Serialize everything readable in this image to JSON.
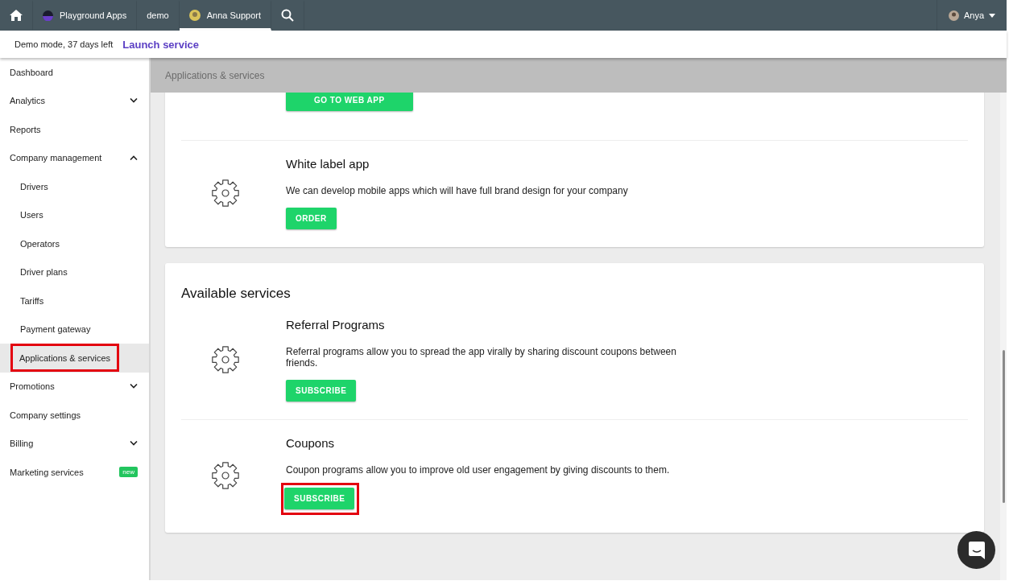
{
  "top_nav": {
    "tabs": [
      {
        "kind": "home",
        "selected": false
      },
      {
        "kind": "logo",
        "label": "Playground Apps",
        "selected": false
      },
      {
        "kind": "text",
        "label": "demo",
        "selected": false
      },
      {
        "kind": "avatar",
        "label": "Anna Support",
        "selected": true
      },
      {
        "kind": "search",
        "selected": false
      }
    ],
    "user": {
      "name": "Anya"
    }
  },
  "demo_bar": {
    "text": "Demo mode, 37 days left",
    "link": "Launch service"
  },
  "sidebar": {
    "items": [
      {
        "label": "Dashboard",
        "selected": false,
        "highlighted": false
      },
      {
        "label": "Analytics",
        "selected": false,
        "highlighted": false,
        "expanded": false
      },
      {
        "label": "Reports",
        "selected": false,
        "highlighted": false
      },
      {
        "label": "Company management",
        "selected": false,
        "highlighted": false,
        "expanded": true,
        "children": [
          {
            "label": "Drivers",
            "selected": false,
            "highlighted": false
          },
          {
            "label": "Users",
            "selected": false,
            "highlighted": false
          },
          {
            "label": "Operators",
            "selected": false,
            "highlighted": false
          },
          {
            "label": "Driver plans",
            "selected": false,
            "highlighted": false
          },
          {
            "label": "Tariffs",
            "selected": false,
            "highlighted": false
          },
          {
            "label": "Payment gateway",
            "selected": false,
            "highlighted": false
          },
          {
            "label": "Applications & services",
            "selected": true,
            "highlighted": true
          }
        ]
      },
      {
        "label": "Promotions",
        "selected": false,
        "highlighted": false,
        "expanded": false
      },
      {
        "label": "Company settings",
        "selected": false,
        "highlighted": false
      },
      {
        "label": "Billing",
        "selected": false,
        "highlighted": false,
        "expanded": false
      },
      {
        "label": "Marketing services",
        "selected": false,
        "highlighted": false,
        "badge": "new"
      }
    ]
  },
  "page_header": {
    "title": "Applications & services"
  },
  "cards": [
    {
      "sections": [
        {
          "button": "GO TO WEB APP",
          "highlighted": false
        },
        {
          "title": "White label app",
          "description": "We can develop mobile apps which will have full brand design for your company",
          "button": "ORDER",
          "highlighted": false
        }
      ]
    },
    {
      "title": "Available services",
      "sections": [
        {
          "title": "Referral Programs",
          "description": "Referral programs allow you to spread the app virally by sharing discount coupons between friends.",
          "button": "SUBSCRIBE",
          "highlighted": false
        },
        {
          "title": "Coupons",
          "description": "Coupon programs allow you to improve old user engagement by giving discounts to them.",
          "button": "SUBSCRIBE",
          "highlighted": true
        }
      ]
    }
  ]
}
